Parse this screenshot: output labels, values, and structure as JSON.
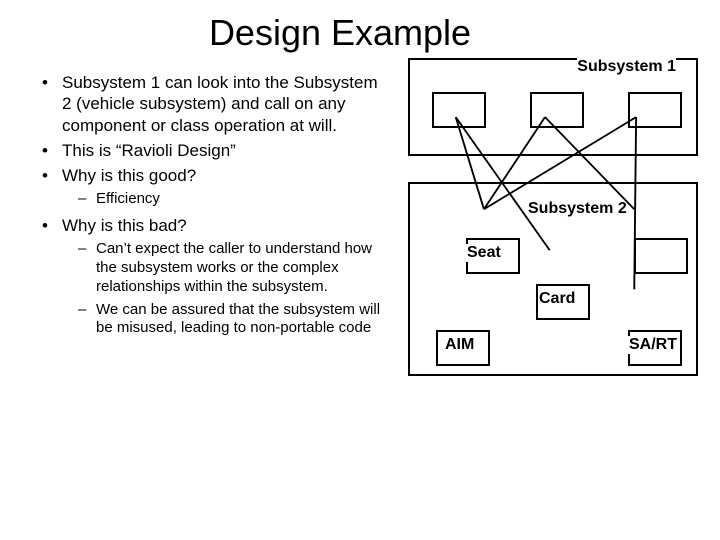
{
  "title": "Design Example",
  "bullets": {
    "b1": "Subsystem 1 can look into the Subsystem 2 (vehicle subsystem) and call on any component or class operation at will.",
    "b2": "This is “Ravioli Design”",
    "b3": "Why is this good?",
    "b3_sub1": "Efficiency",
    "b4": "Why is this bad?",
    "b4_sub1": "Can’t expect the caller to understand how the subsystem works or the complex relationships within the subsystem.",
    "b4_sub2": "We can be assured that the subsystem will be misused, leading to non-portable code"
  },
  "diagram": {
    "sub1_label": "Subsystem 1",
    "sub2_label": "Subsystem 2",
    "box_seat": "Seat",
    "box_card": "Card",
    "box_aim": "AIM",
    "box_sart": "SA/RT"
  }
}
